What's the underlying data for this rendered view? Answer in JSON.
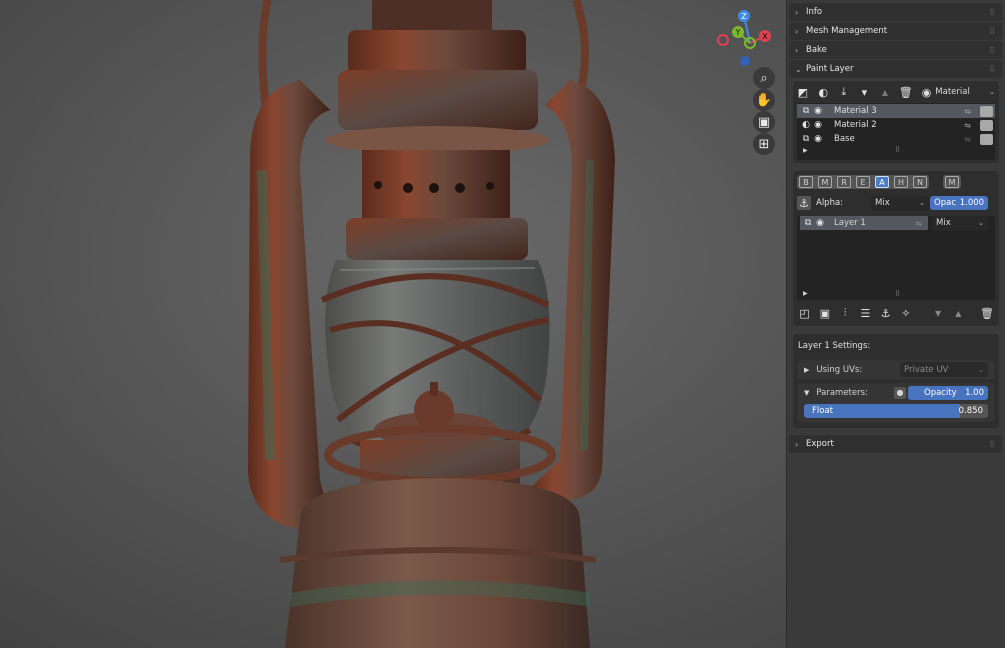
{
  "sidebar": {
    "panels": {
      "info": "Info",
      "mesh_management": "Mesh Management",
      "bake": "Bake",
      "paint_layer": "Paint Layer",
      "export": "Export"
    },
    "material_dropdown": "Material",
    "materials": [
      {
        "name": "Material 3",
        "selected": true
      },
      {
        "name": "Material 2",
        "selected": false
      },
      {
        "name": "Base",
        "selected": false
      }
    ],
    "channels": [
      "B",
      "M",
      "R",
      "E",
      "A",
      "H",
      "N",
      "M"
    ],
    "active_channel": "A",
    "alpha_label": "Alpha:",
    "alpha_blend": "Mix",
    "opacity_label": "Opac",
    "opacity_value": "1.000",
    "layers": [
      {
        "name": "Layer 1",
        "blend": "Mix"
      }
    ],
    "settings_title": "Layer 1 Settings:",
    "using_uvs_label": "Using UVs:",
    "using_uvs_value": "Private UV",
    "parameters_label": "Parameters:",
    "param_opacity_label": "Opacity",
    "param_opacity_value": "1.00",
    "float_label": "Float",
    "float_value": "0.850",
    "float_fraction": 0.85
  },
  "gizmo": {
    "z": "Z",
    "y": "Y",
    "x": "X"
  },
  "colors": {
    "accent": "#4873bf",
    "axis_x": "#e0424f",
    "axis_y": "#7bb82a",
    "axis_z": "#3c8ae6"
  }
}
